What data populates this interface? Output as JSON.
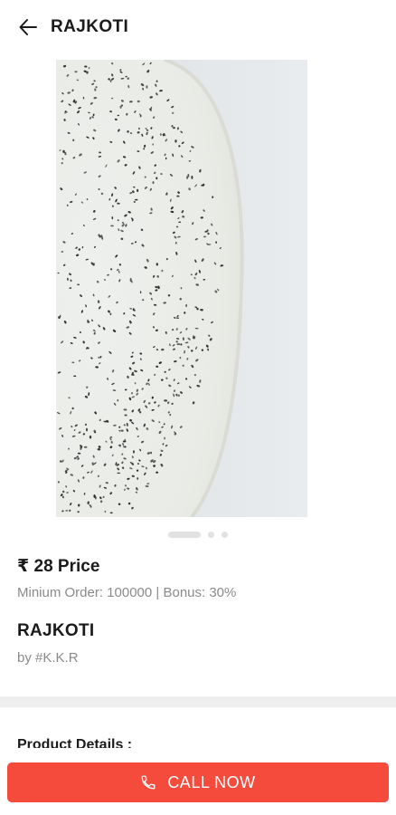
{
  "header": {
    "title": "RAJKOTI",
    "back_icon": "arrow-left-icon"
  },
  "product": {
    "image_alt": "product-photo",
    "carousel": {
      "total": 3,
      "active": 0
    },
    "price": "₹ 28 Price",
    "meta": "Minium Order: 100000 | Bonus: 30%",
    "name": "RAJKOTI",
    "seller": "by #K.K.R"
  },
  "details": {
    "heading": "Product Details :"
  },
  "actions": {
    "call_label": "CALL NOW",
    "call_icon": "phone-icon",
    "accent_color": "#f44b3c"
  }
}
